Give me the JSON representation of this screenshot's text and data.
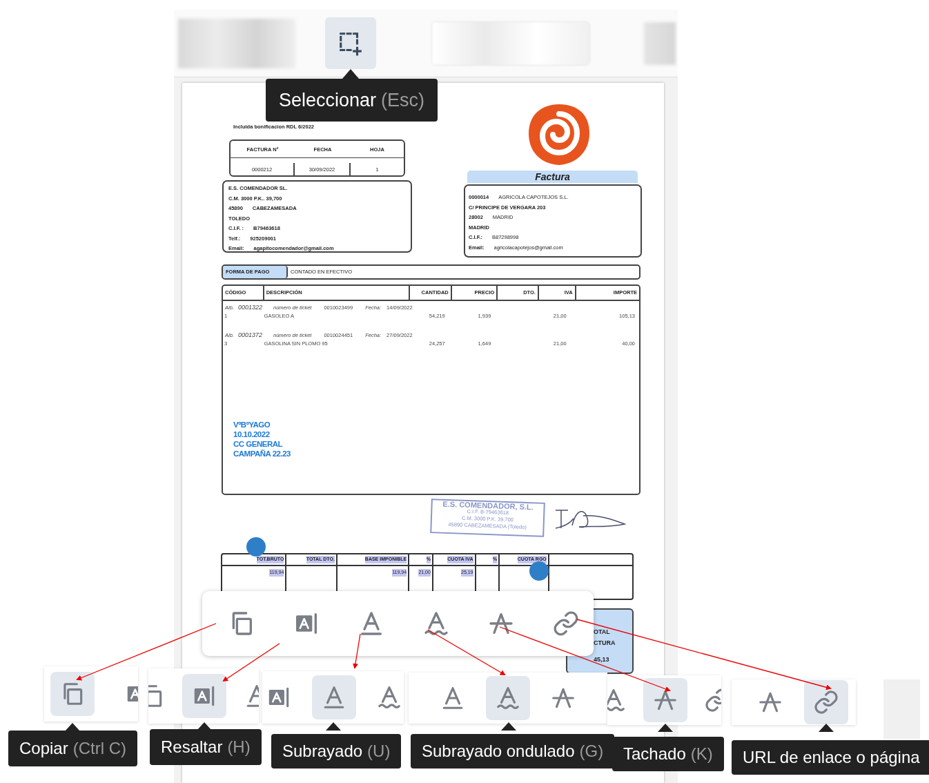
{
  "top_toolbar": {
    "select_tool": {
      "selected": true
    },
    "tooltip": {
      "label": "Seleccionar",
      "shortcut": "(Esc)"
    }
  },
  "document": {
    "note": "Incluida bonificacion RDL 6/2022",
    "invoice_header": {
      "columns": [
        "FACTURA Nº",
        "FECHA",
        "HOJA"
      ],
      "values": [
        "0000212",
        "30/09/2022",
        "1"
      ]
    },
    "issuer": [
      [
        "E.S. COMENDADOR SL."
      ],
      [
        "C.M. 3000 P.K.. 39,700"
      ],
      [
        "45890",
        "CABEZAMESADA"
      ],
      [
        "TOLEDO"
      ],
      [
        "C.I.F. :",
        "B79463618"
      ],
      [
        "Telf.:",
        "925209001"
      ],
      [
        "Email:",
        "agapitocomendador@gmail.com"
      ]
    ],
    "title": "Factura",
    "client": [
      [
        "0000014",
        "AGRICOLA CAPOTEJOS S.L."
      ],
      [
        "C/ PRINCIPE DE VERGARA 203"
      ],
      [
        "28002",
        "MADRID"
      ],
      [
        "MADRID"
      ],
      [
        "C.I.F.:",
        "B87298998"
      ],
      [
        "Email:",
        "agricolacapotejos@gmail.com"
      ]
    ],
    "payment": {
      "label": "FORMA DE PAGO",
      "value": "CONTADO EN EFECTIVO"
    },
    "items_table": {
      "columns": [
        "CÓDIGO",
        "DESCRIPCIÓN",
        "CANTIDAD",
        "PRECIO",
        "DTO.",
        "IVA",
        "IMPORTE"
      ],
      "entries": [
        {
          "note_label": "Alb.",
          "note_number": "0001322",
          "ticket_label": "número de ticket",
          "ticket": "0010023499",
          "date_label": "Fecha:",
          "date": "14/09/2022",
          "code": "1",
          "description": "GASOLEO A",
          "quantity": "54,219",
          "price": "1,939",
          "vat": "21,00",
          "amount": "105,13"
        },
        {
          "note_label": "Alb.",
          "note_number": "0001372",
          "ticket_label": "número de ticket",
          "ticket": "0010024451",
          "date_label": "Fecha:",
          "date": "27/09/2022",
          "code": "3",
          "description": "GASOLINA SIN PLOMO 95",
          "quantity": "24,257",
          "price": "1,649",
          "vat": "21,00",
          "amount": "40,00"
        }
      ]
    },
    "annotation": [
      "VºBºYAGO",
      "10.10.2022",
      "CC GENERAL",
      "CAMPAÑA 22.23"
    ],
    "stamp": [
      "E.S. COMENDADOR, S.L.",
      "C.I.F. B-79463618",
      "C.M. 3000 P.K. 39,700",
      "45890 CABEZAMESADA (Toledo)"
    ],
    "totals": {
      "text_selected": true,
      "columns": [
        {
          "heading": "TOT.BRUTO",
          "value": "119,94"
        },
        {
          "heading": "TOTAL DTO."
        },
        {
          "heading": "BASE IMPONIBLE",
          "value": "119,94"
        },
        {
          "heading": "%",
          "value": "21,00"
        },
        {
          "heading": "CUOTA IVA",
          "value": "25,19"
        },
        {
          "heading": "%"
        },
        {
          "heading": "CUOTA RGO"
        }
      ]
    },
    "grand_total": {
      "label_lines": [
        "OTAL",
        "CTURA"
      ],
      "value": "45,13"
    }
  },
  "selection_toolbar": {
    "tools": [
      {
        "kind": "copy"
      },
      {
        "kind": "highlight"
      },
      {
        "kind": "underline"
      },
      {
        "kind": "wavy"
      },
      {
        "kind": "strike"
      },
      {
        "kind": "link"
      }
    ]
  },
  "zoomed_views": [
    {
      "tools": [
        {
          "kind": "copy",
          "selected": true
        },
        {
          "kind": "highlight",
          "selected": false
        }
      ],
      "tooltip": {
        "label": "Copiar",
        "shortcut": "(Ctrl C)"
      }
    },
    {
      "tools": [
        {
          "kind": "copy",
          "selected": false
        },
        {
          "kind": "highlight",
          "selected": true
        },
        {
          "kind": "underline",
          "selected": false
        }
      ],
      "tooltip": {
        "label": "Resaltar",
        "shortcut": "(H)"
      }
    },
    {
      "tools": [
        {
          "kind": "highlight",
          "selected": false
        },
        {
          "kind": "underline",
          "selected": true
        },
        {
          "kind": "wavy",
          "selected": false
        }
      ],
      "tooltip": {
        "label": "Subrayado",
        "shortcut": "(U)"
      }
    },
    {
      "tools": [
        {
          "kind": "underline",
          "selected": false
        },
        {
          "kind": "wavy",
          "selected": true
        },
        {
          "kind": "strike",
          "selected": false
        }
      ],
      "tooltip": {
        "label": "Subrayado ondulado",
        "shortcut": "(G)"
      }
    },
    {
      "tools": [
        {
          "kind": "wavy",
          "selected": false
        },
        {
          "kind": "strike",
          "selected": true
        },
        {
          "kind": "link",
          "selected": false
        }
      ],
      "tooltip": {
        "label": "Tachado",
        "shortcut": "(K)"
      }
    },
    {
      "tools": [
        {
          "kind": "strike",
          "selected": false
        },
        {
          "kind": "link",
          "selected": true
        }
      ],
      "tooltip": {
        "label": "URL de enlace o página"
      }
    }
  ]
}
